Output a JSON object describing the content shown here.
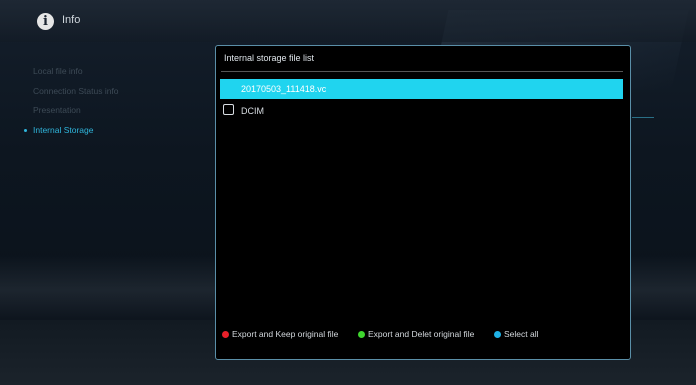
{
  "header": {
    "title": "Info",
    "icon": "info-icon"
  },
  "side_menu": {
    "items": [
      {
        "label": "Local file info",
        "active": false
      },
      {
        "label": "Connection Status info",
        "active": false
      },
      {
        "label": "Presentation",
        "active": false
      },
      {
        "label": "Internal Storage",
        "active": true
      }
    ]
  },
  "dialog": {
    "title": "Internal storage file list",
    "files": [
      {
        "name": "20170503_111418.vc",
        "selected": true
      },
      {
        "name": "DCIM",
        "selected": false
      }
    ],
    "actions": [
      {
        "label": "Export and Keep original file",
        "color": "#e8202a"
      },
      {
        "label": "Export and Delet original file",
        "color": "#3fd62f"
      },
      {
        "label": "Select all",
        "color": "#1fb2e6"
      }
    ]
  },
  "colors": {
    "accent": "#20d4ef",
    "border": "#5a8fa8",
    "menu_active": "#2fb6dc"
  }
}
